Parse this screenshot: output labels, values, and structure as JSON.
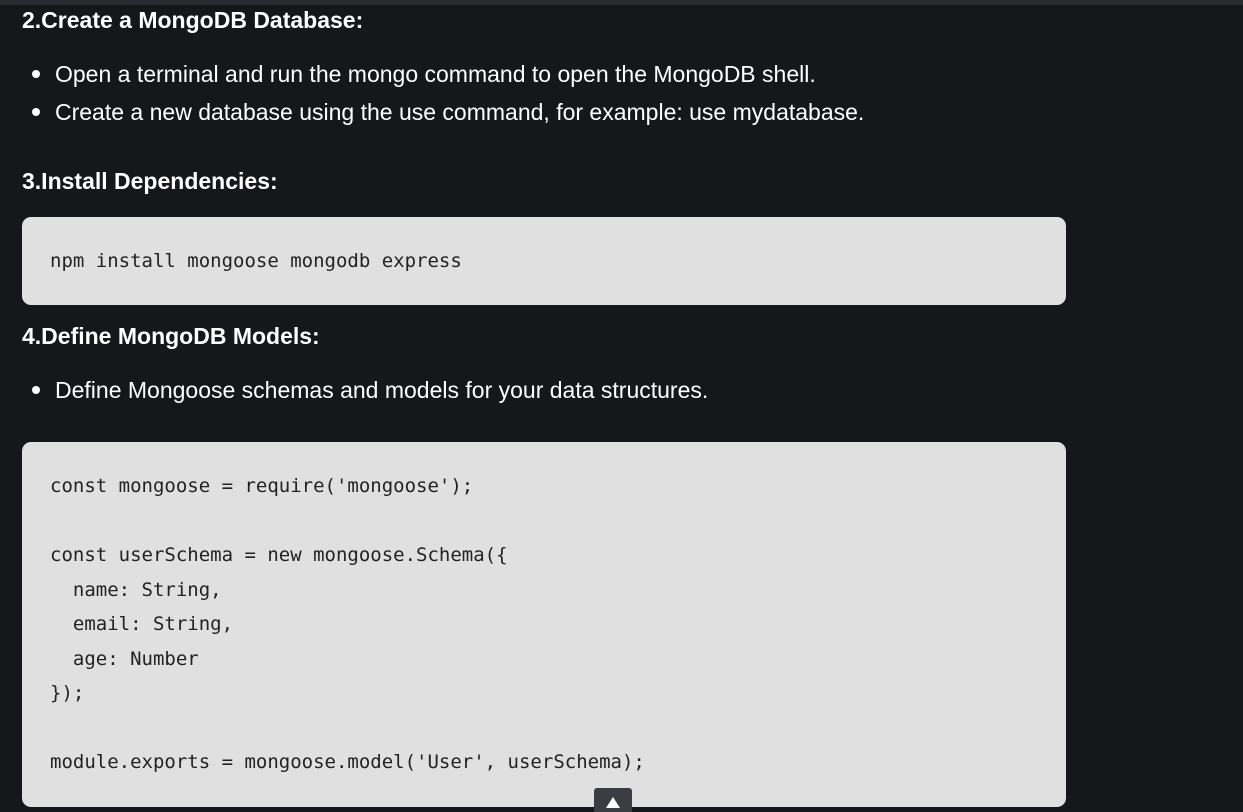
{
  "section2": {
    "heading": "2.Create a MongoDB Database:",
    "bullets": [
      "Open a terminal and run the mongo command to open the MongoDB shell.",
      "Create a new database using the use command, for example: use mydatabase."
    ]
  },
  "section3": {
    "heading": "3.Install Dependencies:",
    "code": [
      "npm install mongoose mongodb express"
    ]
  },
  "section4": {
    "heading": "4.Define MongoDB Models:",
    "bullets": [
      "Define Mongoose schemas and models for your data structures."
    ],
    "code": [
      "const mongoose = require('mongoose');",
      "",
      "const userSchema = new mongoose.Schema({",
      "  name: String,",
      "  email: String,",
      "  age: Number",
      "});",
      "",
      "module.exports = mongoose.model('User', userSchema);"
    ]
  },
  "scroll_top": {
    "icon": "arrow-up-icon"
  }
}
